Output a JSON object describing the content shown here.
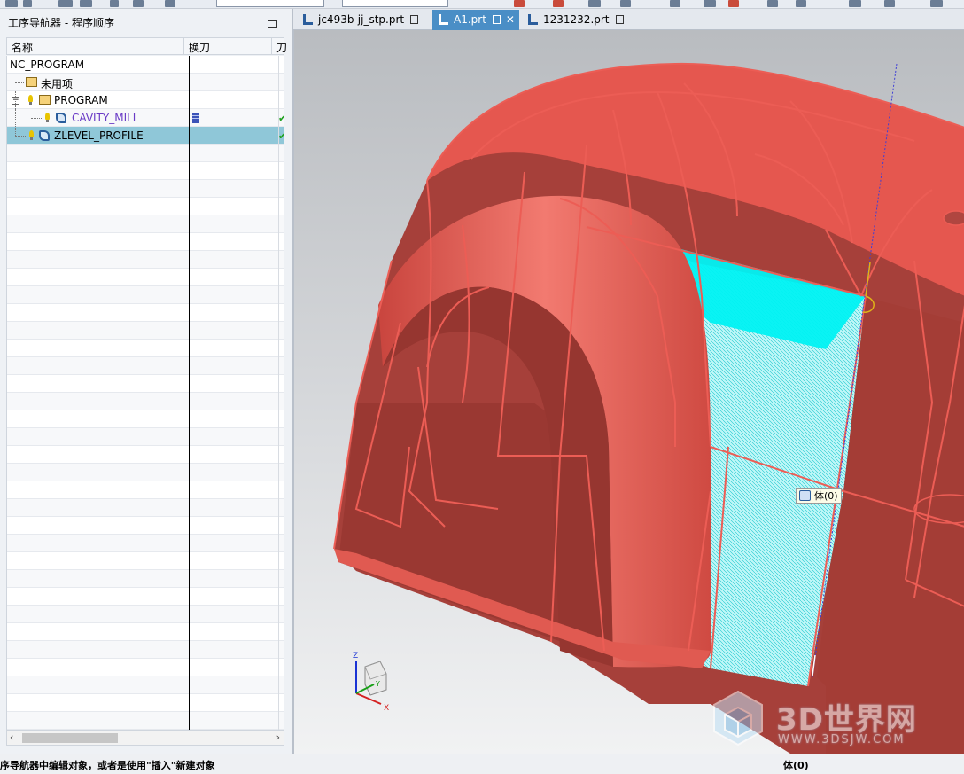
{
  "navigator": {
    "title": "工序导航器 - 程序顺序",
    "columns": {
      "name": "名称",
      "tool_change": "换刀",
      "extra": "刀"
    },
    "rows": [
      {
        "label": "NC_PROGRAM",
        "tool_icon": false,
        "check": false
      },
      {
        "label": "未用项",
        "tool_icon": false,
        "check": false
      },
      {
        "label": "PROGRAM",
        "tool_icon": false,
        "check": false
      },
      {
        "label": "CAVITY_MILL",
        "tool_icon": true,
        "check": true
      },
      {
        "label": "ZLEVEL_PROFILE",
        "tool_icon": false,
        "check": true,
        "selected": true
      }
    ]
  },
  "tabs": [
    {
      "label": "jc493b-jj_stp.prt",
      "active": false
    },
    {
      "label": "A1.prt",
      "active": true
    },
    {
      "label": "1231232.prt",
      "active": false
    }
  ],
  "viewport": {
    "tooltip": "体(0)",
    "axes": {
      "z": "Z",
      "x": "X",
      "y": "Y"
    },
    "watermark": {
      "title": "3D世界网",
      "url": "WWW.3DSJW.COM"
    },
    "colors": {
      "part": "#e5574f",
      "part_dark": "#9c3a32",
      "edge": "#e25a52",
      "toolpath": "#00f4f4"
    }
  },
  "status": {
    "message": "序导航器中编辑对象，或者是使用\"插入\"新建对象",
    "selection": "体(0)"
  }
}
